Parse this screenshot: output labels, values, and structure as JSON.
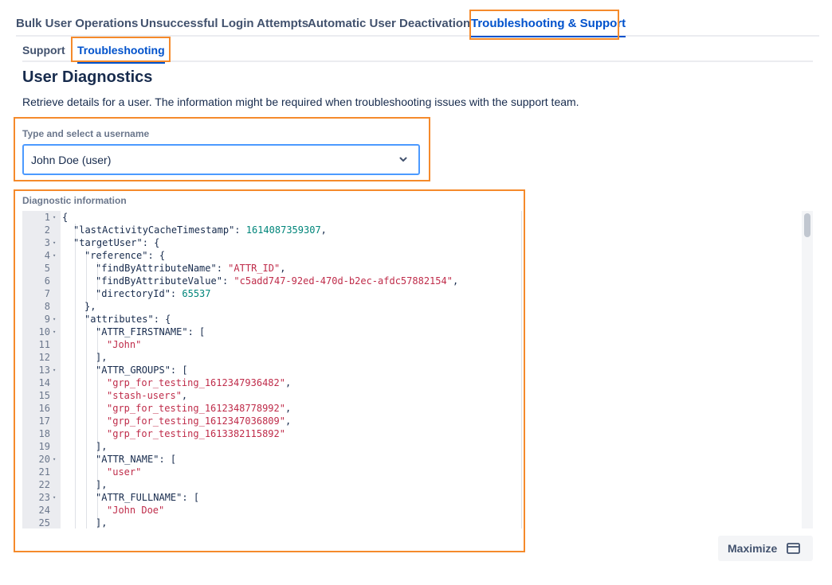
{
  "tabs": [
    {
      "label": "Bulk User Operations",
      "active": false
    },
    {
      "label": "Unsuccessful Login Attempts",
      "active": false
    },
    {
      "label": "Automatic User Deactivation",
      "active": false
    },
    {
      "label": "Troubleshooting & Support",
      "active": true
    }
  ],
  "subtabs": [
    {
      "label": "Support",
      "active": false
    },
    {
      "label": "Troubleshooting",
      "active": true
    }
  ],
  "page": {
    "title": "User Diagnostics",
    "description": "Retrieve details for a user. The information might be required when troubleshooting issues with the support team."
  },
  "user_select": {
    "label": "Type and select a username",
    "value": "John Doe (user)",
    "icon": "chevron-down-icon"
  },
  "diagnostics": {
    "label": "Diagnostic information",
    "lines": [
      {
        "n": "1",
        "fold": true,
        "indent": 0,
        "tokens": [
          [
            "p",
            "{"
          ]
        ]
      },
      {
        "n": "2",
        "fold": false,
        "indent": 1,
        "tokens": [
          [
            "k",
            "\"lastActivityCacheTimestamp\""
          ],
          [
            "p",
            ": "
          ],
          [
            "n",
            "1614087359307"
          ],
          [
            "p",
            ","
          ]
        ]
      },
      {
        "n": "3",
        "fold": true,
        "indent": 1,
        "tokens": [
          [
            "k",
            "\"targetUser\""
          ],
          [
            "p",
            ": {"
          ]
        ]
      },
      {
        "n": "4",
        "fold": true,
        "indent": 2,
        "tokens": [
          [
            "k",
            "\"reference\""
          ],
          [
            "p",
            ": {"
          ]
        ]
      },
      {
        "n": "5",
        "fold": false,
        "indent": 3,
        "tokens": [
          [
            "k",
            "\"findByAttributeName\""
          ],
          [
            "p",
            ": "
          ],
          [
            "s",
            "\"ATTR_ID\""
          ],
          [
            "p",
            ","
          ]
        ]
      },
      {
        "n": "6",
        "fold": false,
        "indent": 3,
        "tokens": [
          [
            "k",
            "\"findByAttributeValue\""
          ],
          [
            "p",
            ": "
          ],
          [
            "s",
            "\"c5add747-92ed-470d-b2ec-afdc57882154\""
          ],
          [
            "p",
            ","
          ]
        ]
      },
      {
        "n": "7",
        "fold": false,
        "indent": 3,
        "tokens": [
          [
            "k",
            "\"directoryId\""
          ],
          [
            "p",
            ": "
          ],
          [
            "n",
            "65537"
          ]
        ]
      },
      {
        "n": "8",
        "fold": false,
        "indent": 2,
        "tokens": [
          [
            "p",
            "},"
          ]
        ]
      },
      {
        "n": "9",
        "fold": true,
        "indent": 2,
        "tokens": [
          [
            "k",
            "\"attributes\""
          ],
          [
            "p",
            ": {"
          ]
        ]
      },
      {
        "n": "10",
        "fold": true,
        "indent": 3,
        "tokens": [
          [
            "k",
            "\"ATTR_FIRSTNAME\""
          ],
          [
            "p",
            ": ["
          ]
        ]
      },
      {
        "n": "11",
        "fold": false,
        "indent": 4,
        "tokens": [
          [
            "s",
            "\"John\""
          ]
        ]
      },
      {
        "n": "12",
        "fold": false,
        "indent": 3,
        "tokens": [
          [
            "p",
            "],"
          ]
        ]
      },
      {
        "n": "13",
        "fold": true,
        "indent": 3,
        "tokens": [
          [
            "k",
            "\"ATTR_GROUPS\""
          ],
          [
            "p",
            ": ["
          ]
        ]
      },
      {
        "n": "14",
        "fold": false,
        "indent": 4,
        "tokens": [
          [
            "s",
            "\"grp_for_testing_1612347936482\""
          ],
          [
            "p",
            ","
          ]
        ]
      },
      {
        "n": "15",
        "fold": false,
        "indent": 4,
        "tokens": [
          [
            "s",
            "\"stash-users\""
          ],
          [
            "p",
            ","
          ]
        ]
      },
      {
        "n": "16",
        "fold": false,
        "indent": 4,
        "tokens": [
          [
            "s",
            "\"grp_for_testing_1612348778992\""
          ],
          [
            "p",
            ","
          ]
        ]
      },
      {
        "n": "17",
        "fold": false,
        "indent": 4,
        "tokens": [
          [
            "s",
            "\"grp_for_testing_1612347036809\""
          ],
          [
            "p",
            ","
          ]
        ]
      },
      {
        "n": "18",
        "fold": false,
        "indent": 4,
        "tokens": [
          [
            "s",
            "\"grp_for_testing_1613382115892\""
          ]
        ]
      },
      {
        "n": "19",
        "fold": false,
        "indent": 3,
        "tokens": [
          [
            "p",
            "],"
          ]
        ]
      },
      {
        "n": "20",
        "fold": true,
        "indent": 3,
        "tokens": [
          [
            "k",
            "\"ATTR_NAME\""
          ],
          [
            "p",
            ": ["
          ]
        ]
      },
      {
        "n": "21",
        "fold": false,
        "indent": 4,
        "tokens": [
          [
            "s",
            "\"user\""
          ]
        ]
      },
      {
        "n": "22",
        "fold": false,
        "indent": 3,
        "tokens": [
          [
            "p",
            "],"
          ]
        ]
      },
      {
        "n": "23",
        "fold": true,
        "indent": 3,
        "tokens": [
          [
            "k",
            "\"ATTR_FULLNAME\""
          ],
          [
            "p",
            ": ["
          ]
        ]
      },
      {
        "n": "24",
        "fold": false,
        "indent": 4,
        "tokens": [
          [
            "s",
            "\"John Doe\""
          ]
        ]
      },
      {
        "n": "25",
        "fold": false,
        "indent": 3,
        "tokens": [
          [
            "p",
            "],"
          ]
        ]
      }
    ]
  },
  "maximize": {
    "label": "Maximize",
    "icon": "maximize-icon"
  },
  "colors": {
    "accent": "#0052cc",
    "highlight": "#f58a2b",
    "string": "#bf2c4a",
    "number": "#00857a"
  }
}
